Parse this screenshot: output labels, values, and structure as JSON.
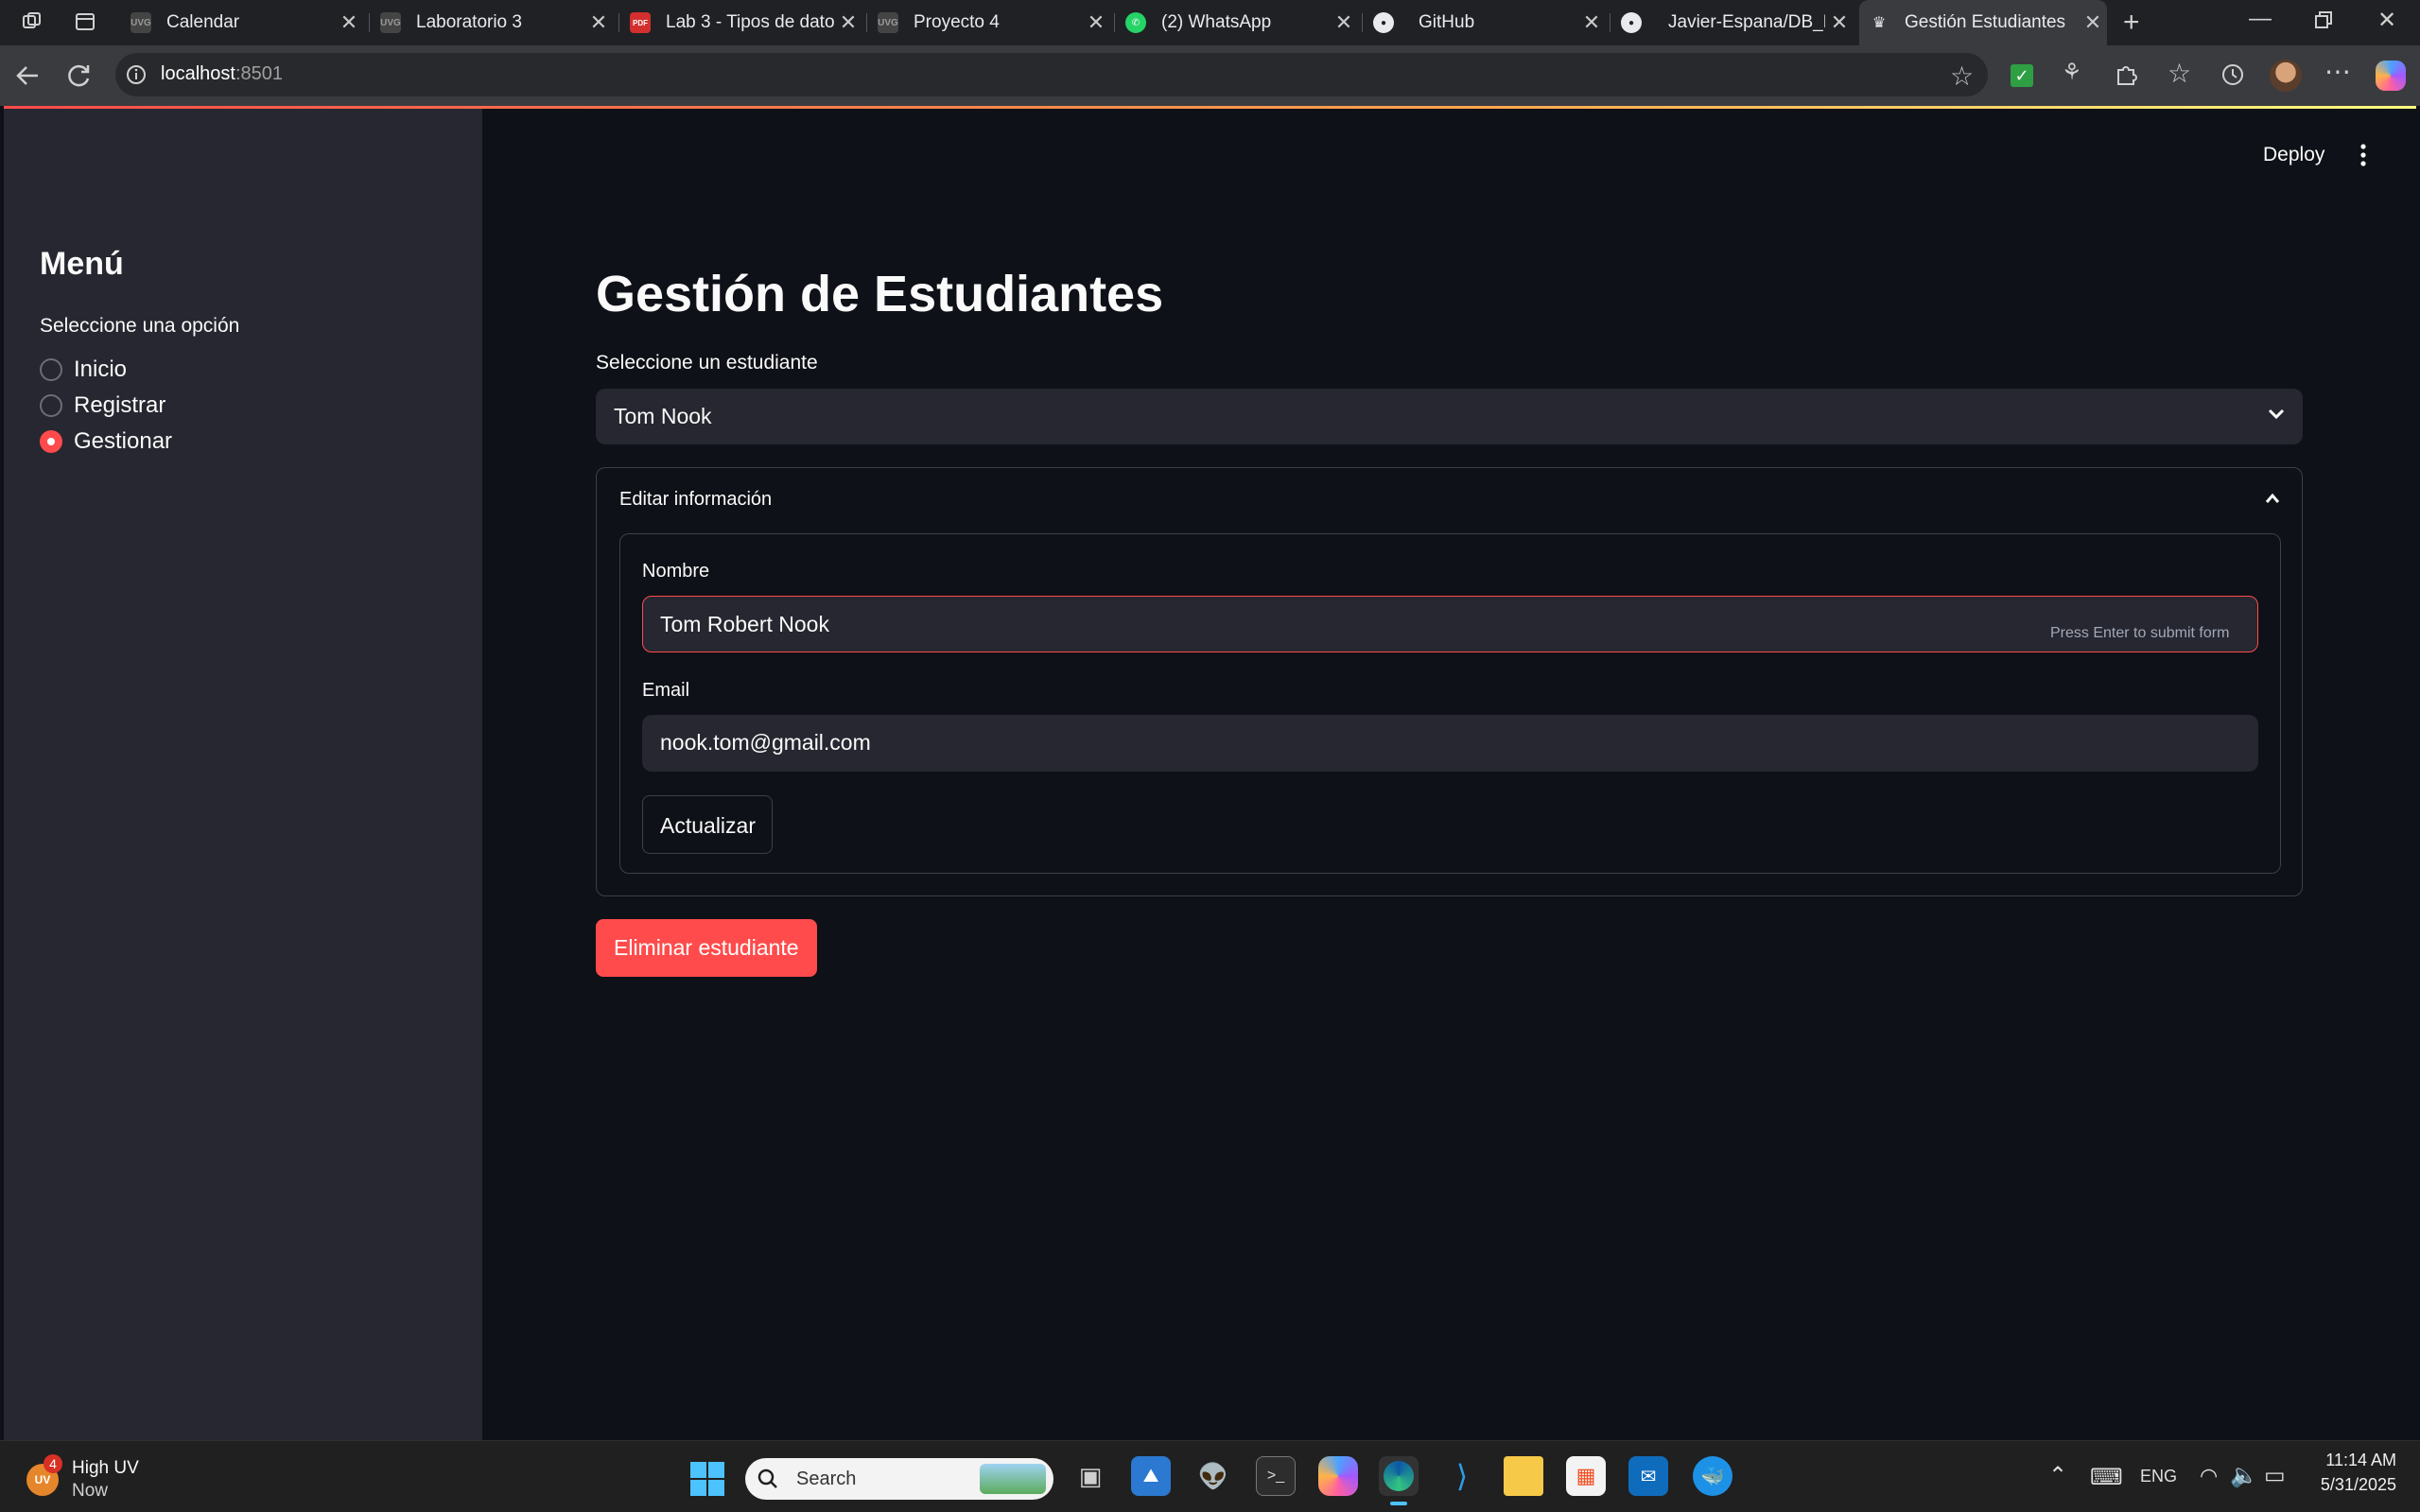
{
  "browser": {
    "tabs": [
      {
        "title": "Calendar",
        "favicon": "UVG"
      },
      {
        "title": "Laboratorio 3",
        "favicon": "UVG"
      },
      {
        "title": "Lab 3 - Tipos de dato",
        "favicon": "PDF"
      },
      {
        "title": "Proyecto 4",
        "favicon": "UVG"
      },
      {
        "title": "(2) WhatsApp",
        "favicon": "whatsapp-icon"
      },
      {
        "title": "GitHub",
        "favicon": "github-icon"
      },
      {
        "title": "Javier-Espana/DB_LAB",
        "favicon": "github-icon"
      },
      {
        "title": "Gestión Estudiantes",
        "favicon": "crown-icon"
      }
    ],
    "address": {
      "host": "localhost",
      "port": ":8501"
    }
  },
  "header": {
    "deploy_label": "Deploy"
  },
  "sidebar": {
    "title": "Menú",
    "radio_label": "Seleccione una opción",
    "options": [
      "Inicio",
      "Registrar",
      "Gestionar"
    ],
    "selected": "Gestionar"
  },
  "main": {
    "title": "Gestión de Estudiantes",
    "select_label": "Seleccione un estudiante",
    "selected_student": "Tom Nook",
    "expander": {
      "label": "Editar información",
      "nombre_label": "Nombre",
      "nombre_value": "Tom Robert Nook",
      "hint": "Press Enter to submit form",
      "email_label": "Email",
      "email_value": "nook.tom@gmail.com",
      "update_button": "Actualizar"
    },
    "delete_button": "Eliminar estudiante"
  },
  "colors": {
    "primary": "#ff4b4b",
    "background": "#0e1117",
    "secondary_background": "#262730"
  },
  "taskbar": {
    "weather": {
      "title": "High UV",
      "subtitle": "Now",
      "badge": "4",
      "icon_text": "UV"
    },
    "search_placeholder": "Search",
    "tray": {
      "language": "ENG",
      "time": "11:14 AM",
      "date": "5/31/2025"
    }
  }
}
